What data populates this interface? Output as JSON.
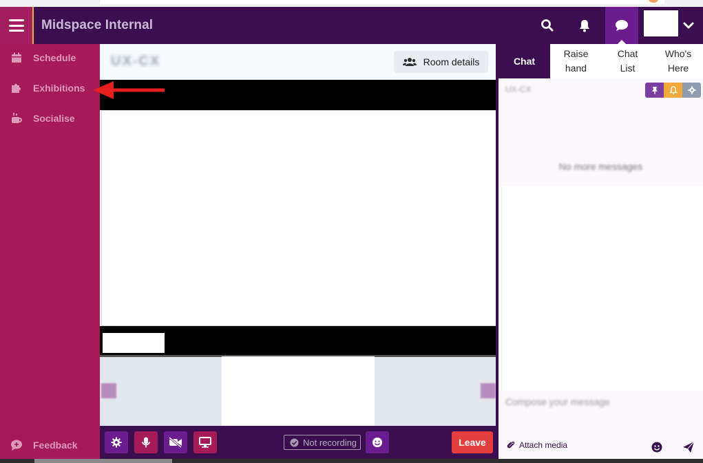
{
  "app": {
    "title": "Midspace Internal"
  },
  "header": {
    "icons": [
      "search-icon",
      "bell-icon",
      "chat-bubble-icon",
      "chevron-down-icon"
    ]
  },
  "sidebar": {
    "items": [
      {
        "label": "Schedule",
        "icon": "calendar-icon"
      },
      {
        "label": "Exhibitions",
        "icon": "puzzle-icon"
      },
      {
        "label": "Socialise",
        "icon": "coffee-icon"
      }
    ],
    "feedback": {
      "label": "Feedback",
      "icon": "comment-plus-icon"
    }
  },
  "room": {
    "title": "UX-CX",
    "details_button": "Room details"
  },
  "controls": {
    "recording_status": "Not recording",
    "leave_label": "Leave"
  },
  "chat": {
    "tabs": [
      {
        "label": "Chat"
      },
      {
        "label": "Raise\nhand"
      },
      {
        "label": "Chat\nList"
      },
      {
        "label": "Who's\nHere"
      }
    ],
    "header_name": "UX-CX",
    "empty_text": "No more messages",
    "compose_placeholder": "Compose your message",
    "attach_label": "Attach media"
  },
  "colors": {
    "header_bg": "#3b0f4f",
    "sidebar_bg": "#a41b58",
    "accent_purple": "#6b1c8e",
    "leave_red": "#e43e3e",
    "pin_purple": "#7b3fa1",
    "bell_orange": "#f2a93b",
    "gear_gray": "#8f9cb0"
  }
}
